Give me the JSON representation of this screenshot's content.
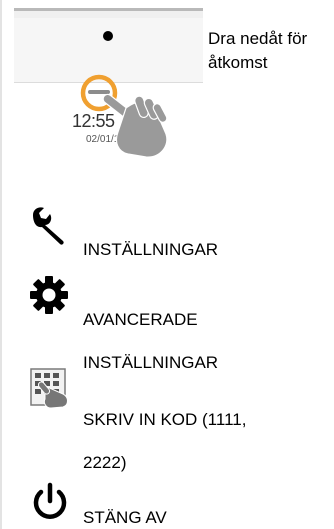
{
  "hint": {
    "line1": "Dra nedåt för",
    "line2": "åtkomst"
  },
  "illustration": {
    "time": "12:55",
    "date": "02/01/18"
  },
  "menu": [
    {
      "icon": "wrench-icon",
      "lines": [
        "INSTÄLLNINGAR"
      ]
    },
    {
      "icon": "gear-icon",
      "lines": [
        "AVANCERADE",
        "INSTÄLLNINGAR"
      ]
    },
    {
      "icon": "keypad-hand-icon",
      "lines": [
        "SKRIV IN KOD (1111,",
        "2222)"
      ]
    },
    {
      "icon": "power-icon",
      "lines": [
        "STÄNG AV"
      ]
    }
  ]
}
